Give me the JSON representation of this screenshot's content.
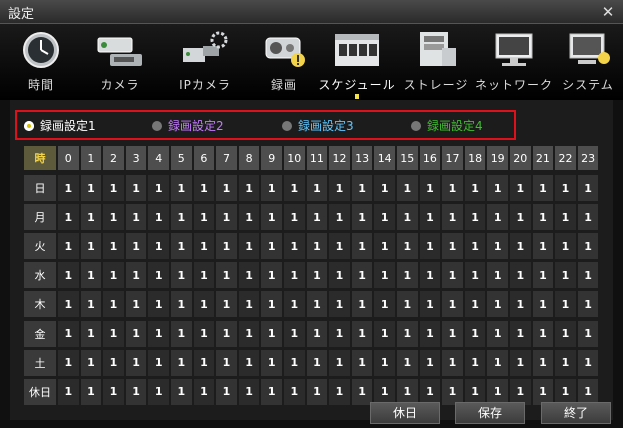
{
  "window": {
    "title": "設定"
  },
  "nav": [
    {
      "label": "時間",
      "icon": "clock-icon"
    },
    {
      "label": "カメラ",
      "icon": "camera-icon"
    },
    {
      "label": "IPカメラ",
      "icon": "ip-camera-icon"
    },
    {
      "label": "録画",
      "icon": "record-icon"
    },
    {
      "label": "スケジュール",
      "icon": "schedule-icon"
    },
    {
      "label": "ストレージ",
      "icon": "storage-icon"
    },
    {
      "label": "ネットワーク",
      "icon": "network-icon"
    },
    {
      "label": "システム",
      "icon": "system-icon"
    }
  ],
  "tabs": [
    {
      "label": "録画設定1",
      "color": "#ffffff",
      "selected": true
    },
    {
      "label": "録画設定2",
      "color": "#c37cff",
      "selected": false
    },
    {
      "label": "録画設定3",
      "color": "#5fc7ff",
      "selected": false
    },
    {
      "label": "録画設定4",
      "color": "#3fbf2f",
      "selected": false
    }
  ],
  "schedule": {
    "corner_label": "時",
    "hours": [
      "0",
      "1",
      "2",
      "3",
      "4",
      "5",
      "6",
      "7",
      "8",
      "9",
      "10",
      "11",
      "12",
      "13",
      "14",
      "15",
      "16",
      "17",
      "18",
      "19",
      "20",
      "21",
      "22",
      "23"
    ],
    "days": [
      "日",
      "月",
      "火",
      "水",
      "木",
      "金",
      "土",
      "休日"
    ],
    "cell_value": "1"
  },
  "buttons": {
    "holiday": "休日",
    "save": "保存",
    "exit": "終了"
  },
  "colors": {
    "highlight": "#e0101b",
    "accent": "#f2e24b"
  }
}
